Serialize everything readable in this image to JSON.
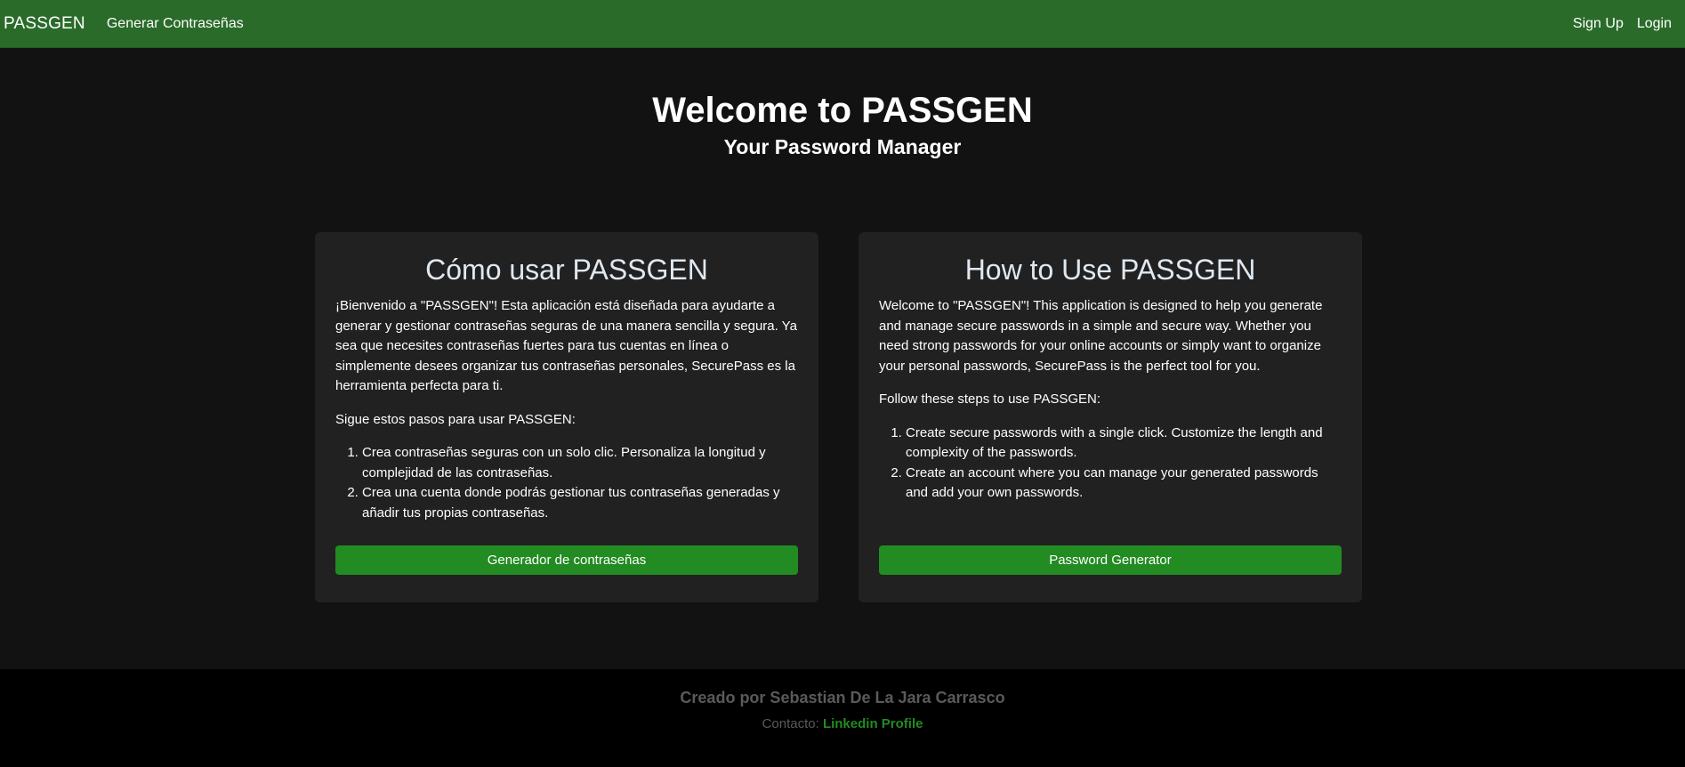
{
  "navbar": {
    "brand": "PASSGEN",
    "generate_link": "Generar Contraseñas",
    "signup": "Sign Up",
    "login": "Login"
  },
  "hero": {
    "title": "Welcome to PASSGEN",
    "subtitle": "Your Password Manager"
  },
  "cards": [
    {
      "title": "Cómo usar PASSGEN",
      "intro": "¡Bienvenido a \"PASSGEN\"! Esta aplicación está diseñada para ayudarte a generar y gestionar contraseñas seguras de una manera sencilla y segura. Ya sea que necesites contraseñas fuertes para tus cuentas en línea o simplemente desees organizar tus contraseñas personales, SecurePass es la herramienta perfecta para ti.",
      "steps_intro": "Sigue estos pasos para usar PASSGEN:",
      "steps": [
        "Crea contraseñas seguras con un solo clic. Personaliza la longitud y complejidad de las contraseñas.",
        "Crea una cuenta donde podrás gestionar tus contraseñas generadas y añadir tus propias contraseñas."
      ],
      "button": "Generador de contraseñas"
    },
    {
      "title": "How to Use PASSGEN",
      "intro": "Welcome to \"PASSGEN\"! This application is designed to help you generate and manage secure passwords in a simple and secure way. Whether you need strong passwords for your online accounts or simply want to organize your personal passwords, SecurePass is the perfect tool for you.",
      "steps_intro": "Follow these steps to use PASSGEN:",
      "steps": [
        "Create secure passwords with a single click. Customize the length and complexity of the passwords.",
        "Create an account where you can manage your generated passwords and add your own passwords."
      ],
      "button": "Password Generator"
    }
  ],
  "footer": {
    "credit": "Creado por Sebastian De La Jara Carrasco",
    "contact_label": "Contacto:",
    "contact_link": "Linkedin Profile"
  },
  "colors": {
    "navbar": "#2a6b2a",
    "button": "#228b22",
    "background": "#121212",
    "card": "#212121"
  }
}
